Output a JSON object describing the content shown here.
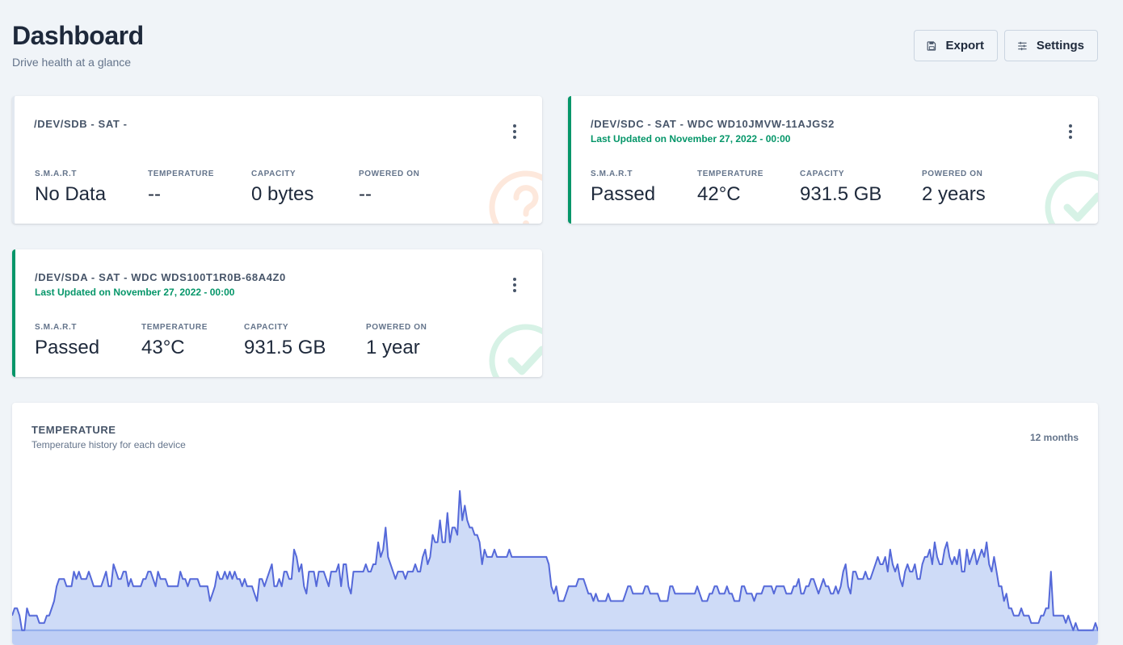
{
  "header": {
    "title": "Dashboard",
    "subtitle": "Drive health at a glance",
    "export_label": "Export",
    "settings_label": "Settings"
  },
  "devices": [
    {
      "title": "/DEV/SDB - SAT -",
      "updated": "",
      "status": "unknown",
      "stats": [
        {
          "label": "S.M.A.R.T",
          "value": "No Data"
        },
        {
          "label": "TEMPERATURE",
          "value": "--"
        },
        {
          "label": "CAPACITY",
          "value": "0 bytes"
        },
        {
          "label": "POWERED ON",
          "value": "--"
        }
      ]
    },
    {
      "title": "/DEV/SDC - SAT - WDC WD10JMVW-11AJGS2",
      "updated": "Last Updated on November 27, 2022 - 00:00",
      "status": "passed",
      "stats": [
        {
          "label": "S.M.A.R.T",
          "value": "Passed"
        },
        {
          "label": "TEMPERATURE",
          "value": "42°C"
        },
        {
          "label": "CAPACITY",
          "value": "931.5 GB"
        },
        {
          "label": "POWERED ON",
          "value": "2 years"
        }
      ]
    },
    {
      "title": "/DEV/SDA - SAT - WDC WDS100T1R0B-68A4Z0",
      "updated": "Last Updated on November 27, 2022 - 00:00",
      "status": "passed",
      "stats": [
        {
          "label": "S.M.A.R.T",
          "value": "Passed"
        },
        {
          "label": "TEMPERATURE",
          "value": "43°C"
        },
        {
          "label": "CAPACITY",
          "value": "931.5 GB"
        },
        {
          "label": "POWERED ON",
          "value": "1 year"
        }
      ]
    }
  ],
  "temperature_chart": {
    "title": "TEMPERATURE",
    "subtitle": "Temperature history for each device",
    "range": "12 months"
  },
  "colors": {
    "accent_ok": "#059669",
    "unknown_icon": "#fde8dc",
    "ok_icon": "#d7f2e6",
    "series_dark": "#5569d9",
    "series_light": "#8fa8ec"
  },
  "chart_data": {
    "type": "area",
    "title": "TEMPERATURE",
    "subtitle": "Temperature history for each device",
    "xlabel": "",
    "ylabel": "",
    "x": [
      0,
      1,
      2,
      3,
      4,
      5,
      6,
      7,
      8,
      9,
      10,
      11,
      12,
      13,
      14,
      15,
      16,
      17,
      18,
      19,
      20,
      21,
      22,
      23,
      24,
      25,
      26,
      27,
      28,
      29,
      30,
      31,
      32,
      33,
      34,
      35,
      36,
      37,
      38,
      39,
      40,
      41,
      42,
      43,
      44,
      45,
      46,
      47,
      48,
      49,
      50,
      51,
      52,
      53,
      54,
      55,
      56,
      57,
      58,
      59,
      60,
      61,
      62,
      63,
      64,
      65,
      66,
      67,
      68,
      69,
      70,
      71,
      72,
      73,
      74,
      75,
      76,
      77,
      78,
      79,
      80,
      81,
      82,
      83,
      84,
      85,
      86,
      87,
      88,
      89,
      90,
      91,
      92,
      93,
      94,
      95,
      96,
      97,
      98,
      99,
      100,
      101,
      102,
      103,
      104,
      105,
      106,
      107,
      108,
      109,
      110,
      111,
      112,
      113,
      114,
      115,
      116,
      117,
      118,
      119,
      120,
      121,
      122,
      123,
      124,
      125,
      126,
      127,
      128,
      129,
      130,
      131,
      132,
      133,
      134,
      135,
      136,
      137,
      138,
      139,
      140,
      141,
      142,
      143,
      144,
      145,
      146,
      147,
      148,
      149,
      150,
      151,
      152,
      153,
      154,
      155,
      156,
      157,
      158,
      159,
      160,
      161,
      162,
      163,
      164,
      165,
      166,
      167,
      168,
      169,
      170,
      171,
      172,
      173,
      174,
      175,
      176,
      177,
      178,
      179,
      180,
      181,
      182,
      183,
      184,
      185,
      186,
      187,
      188,
      189,
      190,
      191,
      192,
      193,
      194,
      195,
      196,
      197,
      198,
      199,
      200,
      201,
      202,
      203,
      204,
      205,
      206,
      207,
      208,
      209,
      210,
      211,
      212,
      213,
      214,
      215,
      216,
      217,
      218,
      219,
      220,
      221,
      222,
      223,
      224,
      225,
      226,
      227,
      228,
      229,
      230,
      231,
      232,
      233,
      234,
      235,
      236,
      237,
      238,
      239,
      240,
      241,
      242,
      243,
      244,
      245,
      246,
      247,
      248,
      249,
      250,
      251,
      252,
      253,
      254,
      255,
      256,
      257,
      258,
      259,
      260,
      261,
      262,
      263,
      264,
      265,
      266,
      267,
      268,
      269,
      270,
      271,
      272,
      273,
      274,
      275,
      276,
      277,
      278,
      279,
      280,
      281,
      282,
      283,
      284,
      285,
      286,
      287,
      288,
      289,
      290,
      291,
      292,
      293,
      294,
      295,
      296,
      297,
      298,
      299,
      300,
      301,
      302,
      303,
      304,
      305,
      306,
      307,
      308,
      309,
      310,
      311,
      312,
      313,
      314,
      315,
      316,
      317,
      318,
      319,
      320,
      321,
      322,
      323,
      324,
      325,
      326,
      327,
      328,
      329,
      330,
      331,
      332,
      333,
      334,
      335,
      336,
      337,
      338,
      339,
      340,
      341,
      342,
      343,
      344,
      345,
      346,
      347,
      348,
      349,
      350,
      351,
      352,
      353,
      354,
      355,
      356,
      357,
      358,
      359,
      360,
      361,
      362,
      363,
      364,
      365,
      366,
      367,
      368,
      369,
      370,
      371,
      372,
      373,
      374,
      375,
      376,
      377,
      378,
      379,
      380,
      381,
      382,
      383,
      384,
      385,
      386,
      387,
      388,
      389,
      390,
      391,
      392,
      393,
      394,
      395,
      396,
      397,
      398,
      399,
      400,
      401,
      402,
      403,
      404,
      405,
      406,
      407,
      408,
      409,
      410,
      411,
      412,
      413,
      414,
      415,
      416,
      417,
      418,
      419,
      420,
      421,
      422,
      423,
      424,
      425,
      426,
      427,
      428,
      429,
      430,
      431,
      432,
      433,
      434,
      435,
      436,
      437,
      438,
      439
    ],
    "series": [
      {
        "values": [
          38,
          39,
          39,
          38,
          36,
          36,
          39,
          38,
          38,
          38,
          38,
          37,
          37,
          37,
          38,
          38,
          39,
          40,
          42,
          43,
          43,
          43,
          42,
          42,
          42,
          44,
          43,
          44,
          43,
          43,
          43,
          44,
          43,
          42,
          42,
          42,
          42,
          43,
          44,
          42,
          42,
          45,
          44,
          43,
          43,
          44,
          44,
          42,
          43,
          42,
          42,
          42,
          42,
          43,
          43,
          44,
          44,
          43,
          42,
          44,
          43,
          43,
          43,
          42,
          42,
          42,
          42,
          42,
          44,
          43,
          43,
          42,
          43,
          43,
          43,
          43,
          42,
          42,
          42,
          42,
          40,
          41,
          42,
          44,
          43,
          43,
          44,
          43,
          44,
          43,
          44,
          43,
          43,
          42,
          43,
          42,
          42,
          42,
          41,
          40,
          43,
          43,
          42,
          43,
          44,
          45,
          42,
          42,
          43,
          42,
          44,
          44,
          43,
          43,
          47,
          46,
          44,
          45,
          42,
          41,
          44,
          44,
          44,
          42,
          44,
          44,
          44,
          43,
          42,
          44,
          44,
          44,
          45,
          42,
          45,
          45,
          42,
          41,
          44,
          44,
          44,
          44,
          44,
          45,
          44,
          44,
          45,
          45,
          48,
          46,
          47,
          50,
          46,
          45,
          44,
          43,
          44,
          44,
          44,
          43,
          44,
          44,
          44,
          45,
          44,
          44,
          46,
          47,
          45,
          46,
          49,
          48,
          48,
          51,
          48,
          48,
          52,
          48,
          50,
          50,
          49,
          55,
          51,
          53,
          51,
          50,
          50,
          49,
          49,
          48,
          45,
          47,
          46,
          46,
          46,
          47,
          46,
          46,
          46,
          46,
          46,
          47,
          46,
          46,
          46,
          46,
          46,
          46,
          46,
          46,
          46,
          46,
          46,
          46,
          46,
          46,
          46,
          45,
          42,
          41,
          42,
          40,
          40,
          40,
          41,
          42,
          42,
          42,
          42,
          43,
          43,
          43,
          42,
          41,
          41,
          40,
          41,
          40,
          40,
          40,
          40,
          41,
          40,
          40,
          40,
          40,
          40,
          40,
          41,
          42,
          42,
          41,
          41,
          41,
          41,
          41,
          42,
          42,
          41,
          41,
          41,
          41,
          40,
          40,
          40,
          40,
          42,
          42,
          41,
          41,
          41,
          41,
          41,
          41,
          41,
          41,
          41,
          42,
          41,
          40,
          40,
          40,
          41,
          41,
          42,
          42,
          41,
          41,
          41,
          42,
          41,
          41,
          40,
          40,
          40,
          42,
          42,
          41,
          41,
          41,
          40,
          41,
          41,
          41,
          42,
          42,
          42,
          42,
          41,
          42,
          42,
          42,
          42,
          41,
          41,
          41,
          42,
          42,
          43,
          41,
          41,
          42,
          42,
          43,
          43,
          42,
          41,
          42,
          43,
          42,
          42,
          41,
          41,
          42,
          41,
          42,
          44,
          45,
          42,
          41,
          44,
          44,
          43,
          43,
          43,
          44,
          43,
          43,
          44,
          45,
          46,
          45,
          45,
          46,
          44,
          47,
          45,
          44,
          45,
          43,
          42,
          44,
          45,
          44,
          44,
          45,
          43,
          43,
          45,
          46,
          46,
          47,
          45,
          48,
          46,
          45,
          45,
          47,
          48,
          46,
          45,
          46,
          45,
          47,
          44,
          44,
          47,
          45,
          46,
          47,
          45,
          46,
          47,
          46,
          48,
          45,
          44,
          46,
          44,
          42,
          42,
          40,
          41,
          39,
          39,
          38,
          38,
          38,
          39,
          38,
          38,
          38,
          37,
          37,
          37,
          37,
          38,
          38,
          39,
          39,
          44,
          38,
          38,
          38,
          38,
          38,
          37,
          38,
          37,
          36,
          37,
          36,
          36,
          36,
          36,
          36,
          36,
          36,
          37,
          36,
          36,
          36,
          36,
          37,
          37,
          36,
          36,
          36,
          36,
          38,
          41,
          36,
          36,
          36,
          36,
          37,
          37,
          36,
          36,
          36,
          38,
          37,
          36,
          37,
          38,
          38,
          36,
          36,
          36,
          36,
          36,
          38,
          37,
          36
        ]
      },
      {
        "values": [
          36,
          36,
          36,
          36,
          36,
          36,
          36,
          36,
          36,
          36,
          36,
          36,
          36,
          36,
          36,
          36,
          36,
          36,
          36,
          36,
          36,
          36,
          36,
          36,
          36,
          36,
          36,
          36,
          36,
          36,
          36,
          36,
          36,
          36,
          36,
          36,
          36,
          36,
          36,
          36,
          36,
          36,
          36,
          36,
          36,
          36,
          36,
          36,
          36,
          36,
          36,
          36,
          36,
          36,
          36,
          36,
          36,
          36,
          36,
          36,
          36,
          36,
          36,
          36,
          36,
          36,
          36,
          36,
          36,
          36,
          36,
          36,
          36,
          36,
          36,
          36,
          36,
          36,
          36,
          36,
          36,
          36,
          36,
          36,
          36,
          36,
          36,
          36,
          36,
          36,
          36,
          36,
          36,
          36,
          36,
          36,
          36,
          36,
          36,
          36,
          36,
          36,
          36,
          36,
          36,
          36,
          36,
          36,
          36,
          36,
          36,
          36,
          36,
          36,
          36,
          36,
          36,
          36,
          36,
          36,
          36,
          36,
          36,
          36,
          36,
          36,
          36,
          36,
          36,
          36,
          36,
          36,
          36,
          36,
          36,
          36,
          36,
          36,
          36,
          36,
          36,
          36,
          36,
          36,
          36,
          36,
          36,
          36,
          36,
          36,
          36,
          36,
          36,
          36,
          36,
          36,
          36,
          36,
          36,
          36,
          36,
          36,
          36,
          36,
          36,
          36,
          36,
          36,
          36,
          36,
          36,
          36,
          36,
          36,
          36,
          36,
          36,
          36,
          36,
          36,
          36,
          36,
          36,
          36,
          36,
          36,
          36,
          36,
          36,
          36,
          36,
          36,
          36,
          36,
          36,
          36,
          36,
          36,
          36,
          36,
          36,
          36,
          36,
          36,
          36,
          36,
          36,
          36,
          36,
          36,
          36,
          36,
          36,
          36,
          36,
          36,
          36,
          36,
          36,
          36,
          36,
          36,
          36,
          36,
          36,
          36,
          36,
          36,
          36,
          36,
          36,
          36,
          36,
          36,
          36,
          36,
          36,
          36,
          36,
          36,
          36,
          36,
          36,
          36,
          36,
          36,
          36,
          36,
          36,
          36,
          36,
          36,
          36,
          36,
          36,
          36,
          36,
          36,
          36,
          36,
          36,
          36,
          36,
          36,
          36,
          36,
          36,
          36,
          36,
          36,
          36,
          36,
          36,
          36,
          36,
          36,
          36,
          36,
          36,
          36,
          36,
          36,
          36,
          36,
          36,
          36,
          36,
          36,
          36,
          36,
          36,
          36,
          36,
          36,
          36,
          36,
          36,
          36,
          36,
          36,
          36,
          36,
          36,
          36,
          36,
          36,
          36,
          36,
          36,
          36,
          36,
          36,
          36,
          36,
          36,
          36,
          36,
          36,
          36,
          36,
          36,
          36,
          36,
          36,
          36,
          36,
          36,
          36,
          36,
          36,
          36,
          36,
          36,
          36,
          36,
          36,
          36,
          36,
          36,
          36,
          36,
          36,
          36,
          36,
          36,
          36,
          36,
          36,
          36,
          36,
          36,
          36,
          36,
          36,
          36,
          36,
          36,
          36,
          36,
          36,
          36,
          36,
          36,
          36,
          36,
          36,
          36,
          36,
          36,
          36,
          36,
          36,
          36,
          36,
          36,
          36,
          36,
          36,
          36,
          36,
          36,
          36,
          36,
          36,
          36,
          36,
          36,
          36,
          36,
          36,
          36,
          36,
          36,
          36,
          36,
          36,
          36,
          36,
          36,
          36,
          36,
          36,
          36,
          36,
          36,
          36,
          36,
          36,
          36,
          36,
          36,
          36,
          36,
          36,
          36,
          36,
          36,
          36,
          36,
          36,
          36,
          36,
          36,
          36,
          36,
          36,
          36,
          36,
          36,
          36,
          36,
          36,
          36,
          36,
          36,
          36,
          36,
          36,
          36,
          36,
          36,
          36,
          36,
          36,
          36,
          36,
          36,
          36,
          36,
          36
        ]
      }
    ]
  }
}
